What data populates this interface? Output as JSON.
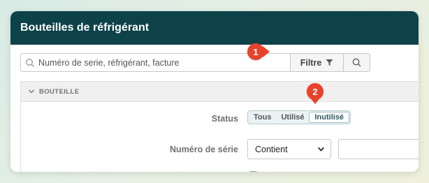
{
  "header": {
    "title": "Bouteilles de réfrigérant"
  },
  "search": {
    "placeholder": "Numéro de serie, réfrigérant, facture",
    "value": "",
    "filter_label": "Filtre"
  },
  "annotations": {
    "step1": "1",
    "step2": "2"
  },
  "section": {
    "title": "BOUTEILLE",
    "status": {
      "label": "Status",
      "options": [
        "Tous",
        "Utilisé",
        "Inutilisé"
      ],
      "selected": "Inutilisé"
    },
    "serial": {
      "label": "Numéro de série",
      "operator": "Contient",
      "value": ""
    }
  },
  "colors": {
    "header_bg": "#0d4249",
    "annotation": "#e8422b",
    "segment_bg": "#eaf2f3"
  },
  "icons": {
    "search_field": "search-icon",
    "filter": "funnel-icon",
    "search_button": "search-icon",
    "section_toggle": "chevron-down-icon",
    "select_arrow": "chevron-down-icon"
  }
}
